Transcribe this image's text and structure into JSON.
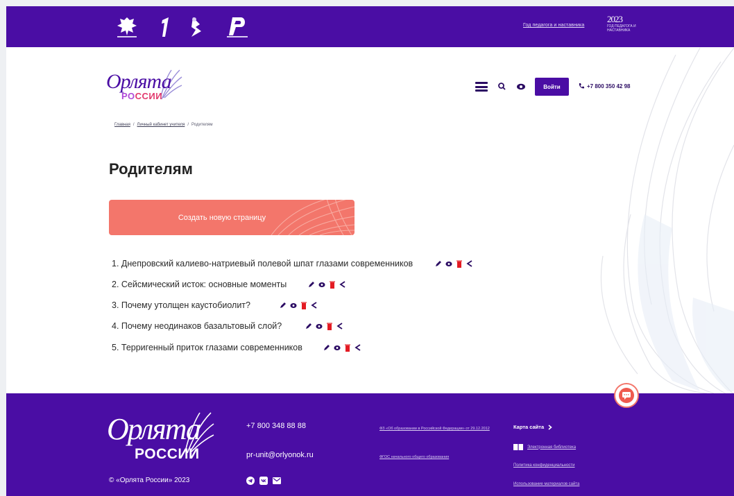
{
  "topbar": {
    "teacher_year_link": "Год педагога и наставника",
    "badge_year": "2023",
    "badge_label": "ГОД ПЕДАГОГА И НАСТАВНИКА",
    "partner_logos": [
      "ministry-emblem-icon",
      "number-one-logo-icon",
      "feather-pen-logo-icon",
      "rosdetcentr-logo-icon"
    ]
  },
  "brand": {
    "line1": "Орлята",
    "line2a": "РО",
    "line2b": "ССИИ"
  },
  "header": {
    "login_label": "Войти",
    "phone": "+7 800 350 42 98"
  },
  "breadcrumb": {
    "items": [
      "Главная",
      "Личный кабинет учителя",
      "Родителям"
    ]
  },
  "page": {
    "title": "Родителям",
    "create_button": "Создать новую страницу"
  },
  "pages_list": [
    {
      "label": "1. Днепровский калиево-натриевый полевой шпат глазами современников"
    },
    {
      "label": "2. Сейсмический исток: основные моменты"
    },
    {
      "label": "3. Почему утолщен каустобиолит?"
    },
    {
      "label": "4. Почему неодинаков базальтовый слой?"
    },
    {
      "label": "5. Терригенный приток глазами современников"
    }
  ],
  "footer": {
    "brand_line1": "Орлята",
    "brand_line2": "РОССИИ",
    "copyright": "© «Орлята России» 2023",
    "phone": "+7 800 348 88 88",
    "email": "pr-unit@orlyonok.ru",
    "doc1": "ФЗ «Об образовании в Российской Федерации» от 29.12.2012",
    "doc2": "ФГОС начального общего образования",
    "site_map": "Карта сайта",
    "library": "Электронная библиотека",
    "privacy": "Политика конфиденциальности",
    "materials": "Использование материалов сайта"
  },
  "colors": {
    "brand_purple": "#4a0da4",
    "accent_coral": "#f3766b",
    "delete_red": "#e31b23"
  }
}
